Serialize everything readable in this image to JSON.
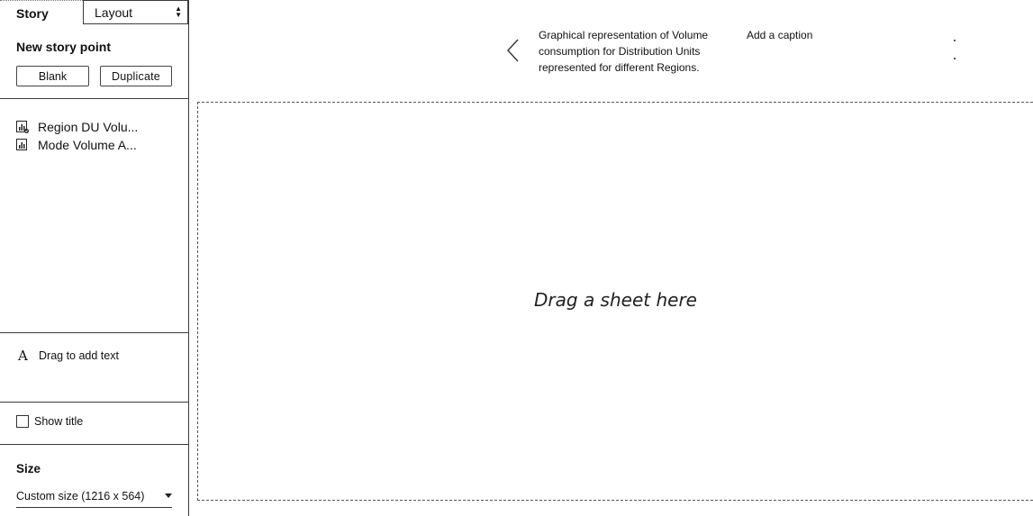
{
  "sidebar": {
    "tabs": {
      "story": "Story",
      "layout": "Layout"
    },
    "new_story_point": {
      "title": "New story point",
      "blank_label": "Blank",
      "duplicate_label": "Duplicate"
    },
    "sheets": [
      {
        "label": "Region DU Volu...",
        "icon": "chart-sheet-used-icon"
      },
      {
        "label": "Mode Volume A...",
        "icon": "chart-sheet-icon"
      }
    ],
    "add_text": {
      "icon": "text-A-icon",
      "label": "Drag to add text"
    },
    "show_title": {
      "label": "Show title",
      "checked": false
    },
    "size": {
      "title": "Size",
      "selected": "Custom size (1216 x 564)"
    }
  },
  "navigator": {
    "caption": "Graphical representation of Volume consumption for Distribution Units represented for different Regions.",
    "add_caption": "Add a caption"
  },
  "canvas": {
    "hint": "Drag a sheet here"
  }
}
